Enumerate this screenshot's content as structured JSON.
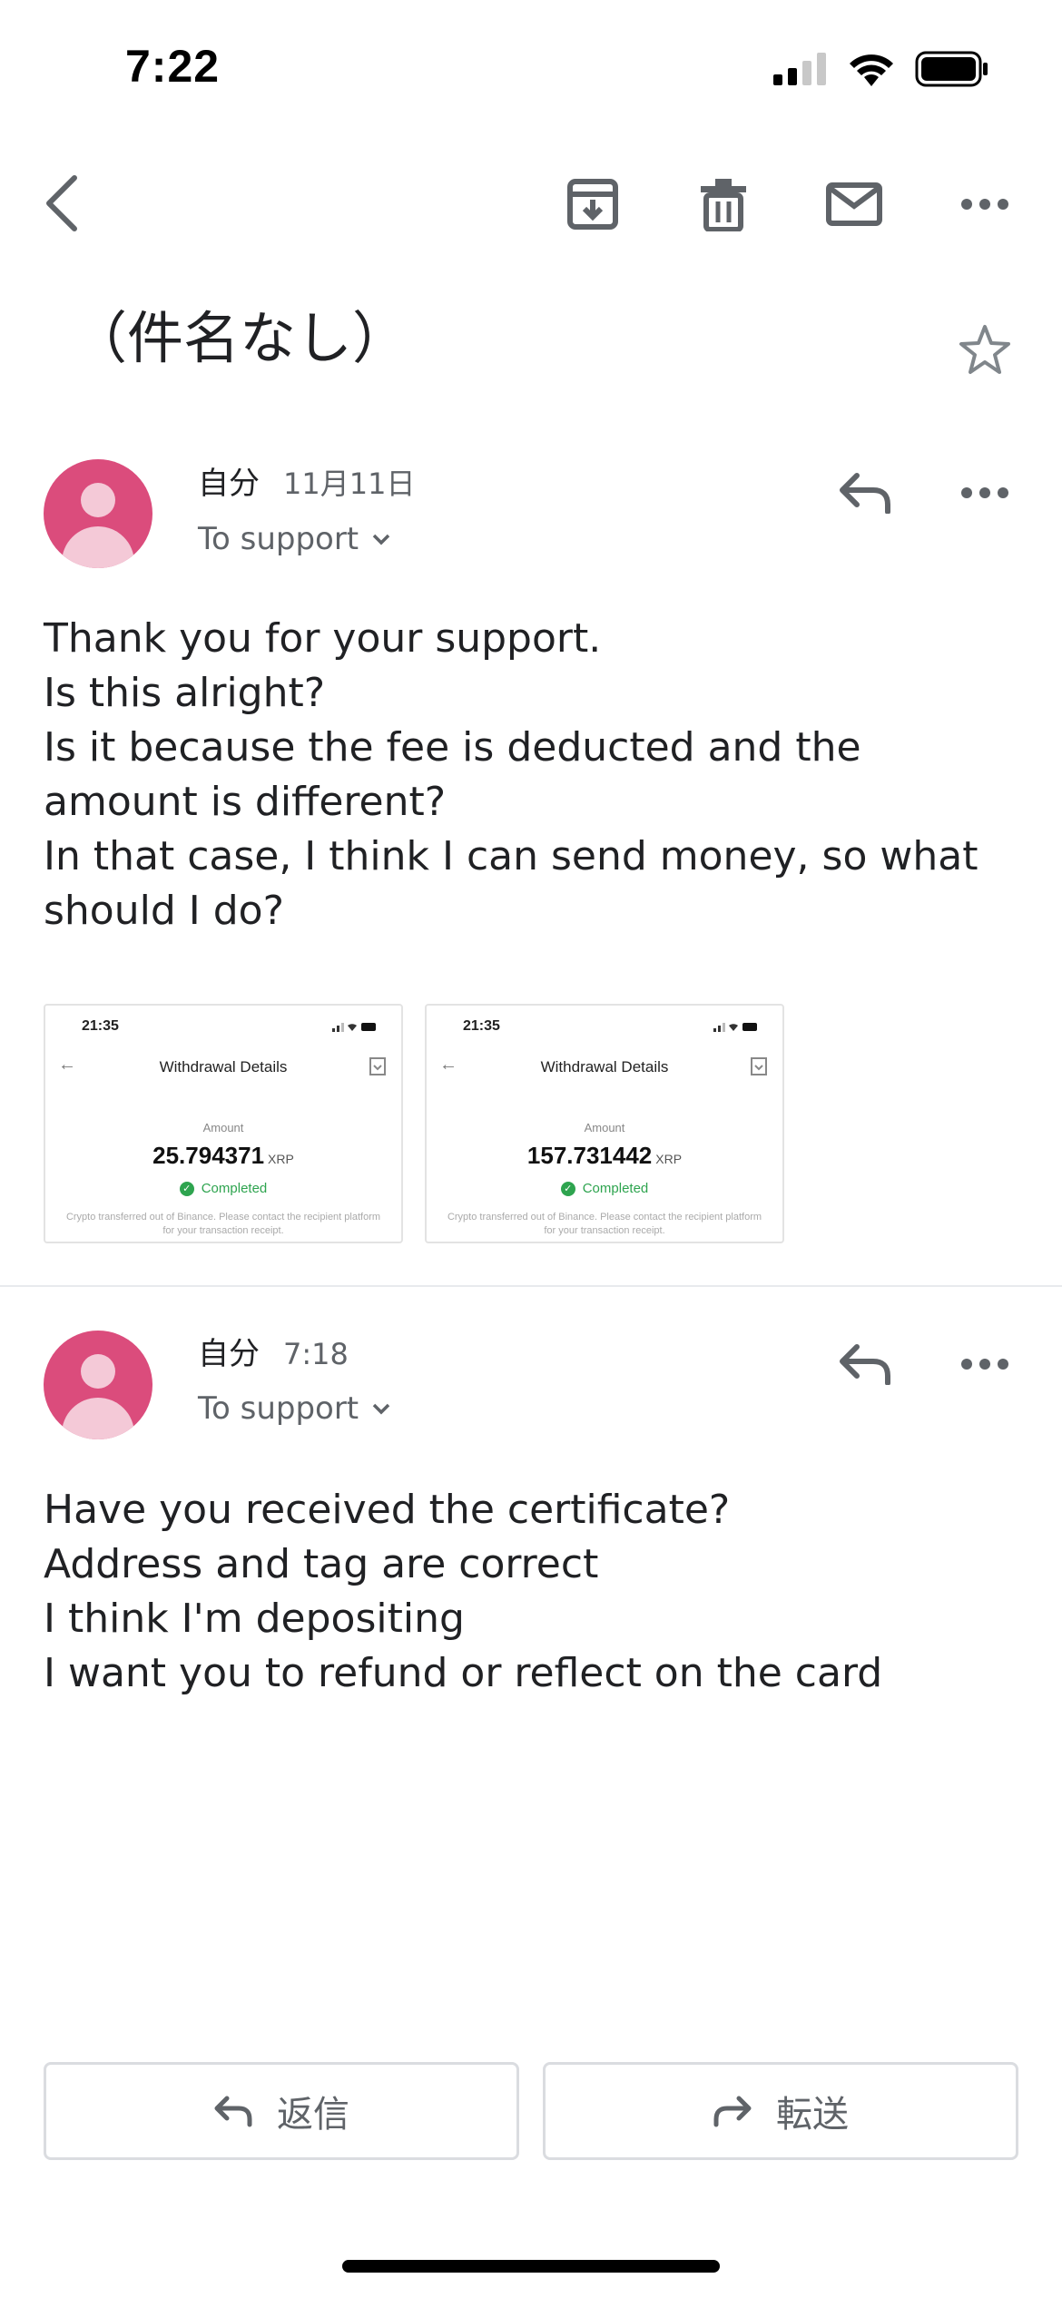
{
  "status_bar": {
    "time": "7:22"
  },
  "toolbar": {
    "icons": [
      "back-icon",
      "archive-icon",
      "trash-icon",
      "mail-icon",
      "more-icon"
    ]
  },
  "subject": "（件名なし）",
  "messages": [
    {
      "sender": "自分",
      "date": "11月11日",
      "recipient": "To support",
      "lines": [
        "Thank you for your support.",
        "Is this alright?",
        "Is it because the fee is deducted and the",
        "amount is different?",
        "In that case, I think I can send money, so what",
        "should I do?"
      ],
      "attachments": [
        {
          "time": "21:35",
          "title": "Withdrawal Details",
          "amount_label": "Amount",
          "amount": "25.794371",
          "unit": "XRP",
          "status": "Completed",
          "note": "Crypto transferred out of Binance. Please contact the recipient platform for your transaction receipt."
        },
        {
          "time": "21:35",
          "title": "Withdrawal Details",
          "amount_label": "Amount",
          "amount": "157.731442",
          "unit": "XRP",
          "status": "Completed",
          "note": "Crypto transferred out of Binance. Please contact the recipient platform for your transaction receipt."
        }
      ]
    },
    {
      "sender": "自分",
      "date": "7:18",
      "recipient": "To support",
      "lines": [
        "Have you received the certificate?",
        "Address and tag are correct",
        "I think I'm depositing",
        "I want you to refund or reflect on the card"
      ]
    }
  ],
  "actions": {
    "reply": "返信",
    "forward": "転送"
  },
  "colors": {
    "avatar": "#db4c7c",
    "text": "#202124",
    "secondary": "#5f6368"
  }
}
